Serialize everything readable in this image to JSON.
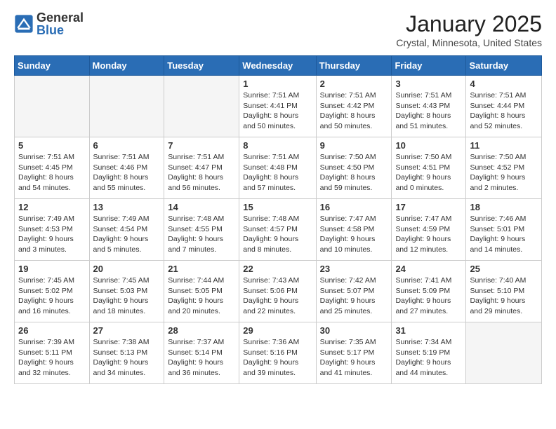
{
  "logo": {
    "general": "General",
    "blue": "Blue"
  },
  "header": {
    "month": "January 2025",
    "location": "Crystal, Minnesota, United States"
  },
  "weekdays": [
    "Sunday",
    "Monday",
    "Tuesday",
    "Wednesday",
    "Thursday",
    "Friday",
    "Saturday"
  ],
  "weeks": [
    [
      {
        "day": null,
        "content": null
      },
      {
        "day": null,
        "content": null
      },
      {
        "day": null,
        "content": null
      },
      {
        "day": "1",
        "content": "Sunrise: 7:51 AM\nSunset: 4:41 PM\nDaylight: 8 hours\nand 50 minutes."
      },
      {
        "day": "2",
        "content": "Sunrise: 7:51 AM\nSunset: 4:42 PM\nDaylight: 8 hours\nand 50 minutes."
      },
      {
        "day": "3",
        "content": "Sunrise: 7:51 AM\nSunset: 4:43 PM\nDaylight: 8 hours\nand 51 minutes."
      },
      {
        "day": "4",
        "content": "Sunrise: 7:51 AM\nSunset: 4:44 PM\nDaylight: 8 hours\nand 52 minutes."
      }
    ],
    [
      {
        "day": "5",
        "content": "Sunrise: 7:51 AM\nSunset: 4:45 PM\nDaylight: 8 hours\nand 54 minutes."
      },
      {
        "day": "6",
        "content": "Sunrise: 7:51 AM\nSunset: 4:46 PM\nDaylight: 8 hours\nand 55 minutes."
      },
      {
        "day": "7",
        "content": "Sunrise: 7:51 AM\nSunset: 4:47 PM\nDaylight: 8 hours\nand 56 minutes."
      },
      {
        "day": "8",
        "content": "Sunrise: 7:51 AM\nSunset: 4:48 PM\nDaylight: 8 hours\nand 57 minutes."
      },
      {
        "day": "9",
        "content": "Sunrise: 7:50 AM\nSunset: 4:50 PM\nDaylight: 8 hours\nand 59 minutes."
      },
      {
        "day": "10",
        "content": "Sunrise: 7:50 AM\nSunset: 4:51 PM\nDaylight: 9 hours\nand 0 minutes."
      },
      {
        "day": "11",
        "content": "Sunrise: 7:50 AM\nSunset: 4:52 PM\nDaylight: 9 hours\nand 2 minutes."
      }
    ],
    [
      {
        "day": "12",
        "content": "Sunrise: 7:49 AM\nSunset: 4:53 PM\nDaylight: 9 hours\nand 3 minutes."
      },
      {
        "day": "13",
        "content": "Sunrise: 7:49 AM\nSunset: 4:54 PM\nDaylight: 9 hours\nand 5 minutes."
      },
      {
        "day": "14",
        "content": "Sunrise: 7:48 AM\nSunset: 4:55 PM\nDaylight: 9 hours\nand 7 minutes."
      },
      {
        "day": "15",
        "content": "Sunrise: 7:48 AM\nSunset: 4:57 PM\nDaylight: 9 hours\nand 8 minutes."
      },
      {
        "day": "16",
        "content": "Sunrise: 7:47 AM\nSunset: 4:58 PM\nDaylight: 9 hours\nand 10 minutes."
      },
      {
        "day": "17",
        "content": "Sunrise: 7:47 AM\nSunset: 4:59 PM\nDaylight: 9 hours\nand 12 minutes."
      },
      {
        "day": "18",
        "content": "Sunrise: 7:46 AM\nSunset: 5:01 PM\nDaylight: 9 hours\nand 14 minutes."
      }
    ],
    [
      {
        "day": "19",
        "content": "Sunrise: 7:45 AM\nSunset: 5:02 PM\nDaylight: 9 hours\nand 16 minutes."
      },
      {
        "day": "20",
        "content": "Sunrise: 7:45 AM\nSunset: 5:03 PM\nDaylight: 9 hours\nand 18 minutes."
      },
      {
        "day": "21",
        "content": "Sunrise: 7:44 AM\nSunset: 5:05 PM\nDaylight: 9 hours\nand 20 minutes."
      },
      {
        "day": "22",
        "content": "Sunrise: 7:43 AM\nSunset: 5:06 PM\nDaylight: 9 hours\nand 22 minutes."
      },
      {
        "day": "23",
        "content": "Sunrise: 7:42 AM\nSunset: 5:07 PM\nDaylight: 9 hours\nand 25 minutes."
      },
      {
        "day": "24",
        "content": "Sunrise: 7:41 AM\nSunset: 5:09 PM\nDaylight: 9 hours\nand 27 minutes."
      },
      {
        "day": "25",
        "content": "Sunrise: 7:40 AM\nSunset: 5:10 PM\nDaylight: 9 hours\nand 29 minutes."
      }
    ],
    [
      {
        "day": "26",
        "content": "Sunrise: 7:39 AM\nSunset: 5:11 PM\nDaylight: 9 hours\nand 32 minutes."
      },
      {
        "day": "27",
        "content": "Sunrise: 7:38 AM\nSunset: 5:13 PM\nDaylight: 9 hours\nand 34 minutes."
      },
      {
        "day": "28",
        "content": "Sunrise: 7:37 AM\nSunset: 5:14 PM\nDaylight: 9 hours\nand 36 minutes."
      },
      {
        "day": "29",
        "content": "Sunrise: 7:36 AM\nSunset: 5:16 PM\nDaylight: 9 hours\nand 39 minutes."
      },
      {
        "day": "30",
        "content": "Sunrise: 7:35 AM\nSunset: 5:17 PM\nDaylight: 9 hours\nand 41 minutes."
      },
      {
        "day": "31",
        "content": "Sunrise: 7:34 AM\nSunset: 5:19 PM\nDaylight: 9 hours\nand 44 minutes."
      },
      {
        "day": null,
        "content": null
      }
    ]
  ]
}
